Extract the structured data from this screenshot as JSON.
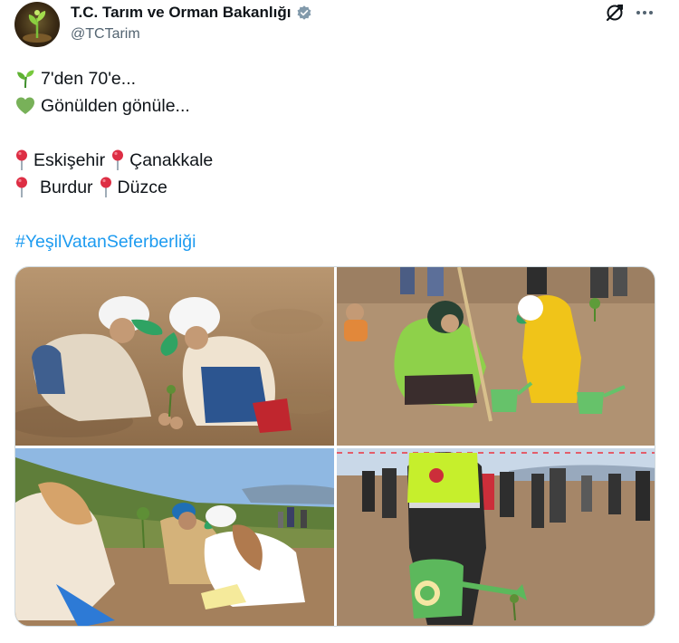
{
  "author": {
    "display_name": "T.C. Tarım ve Orman Bakanlığı",
    "handle": "@TCTarim",
    "verified_color": "#829aab"
  },
  "icons": {
    "verified": "verified-badge-icon",
    "grok": "grok-icon",
    "more": "more-options-icon",
    "line1": "seedling-icon",
    "line2": "green-heart-icon",
    "pin": "round-pushpin-icon"
  },
  "tweet": {
    "line1": "7'den 70'e...",
    "line2": "Gönülden gönüle...",
    "loc1": "Eskişehir",
    "loc2": "Çanakkale",
    "loc3": "Burdur",
    "loc4": "Düzce",
    "hashtag": "#YeşilVatanSeferberliği"
  },
  "colors": {
    "text": "#0f1419",
    "secondary": "#536471",
    "link": "#1d9bf0"
  },
  "media": [
    {
      "subject": "children-planting-saplings-photo"
    },
    {
      "subject": "volunteers-planting-with-watering-can-photo"
    },
    {
      "subject": "children-and-soldier-planting-photo"
    },
    {
      "subject": "police-officer-watering-sapling-photo"
    }
  ]
}
